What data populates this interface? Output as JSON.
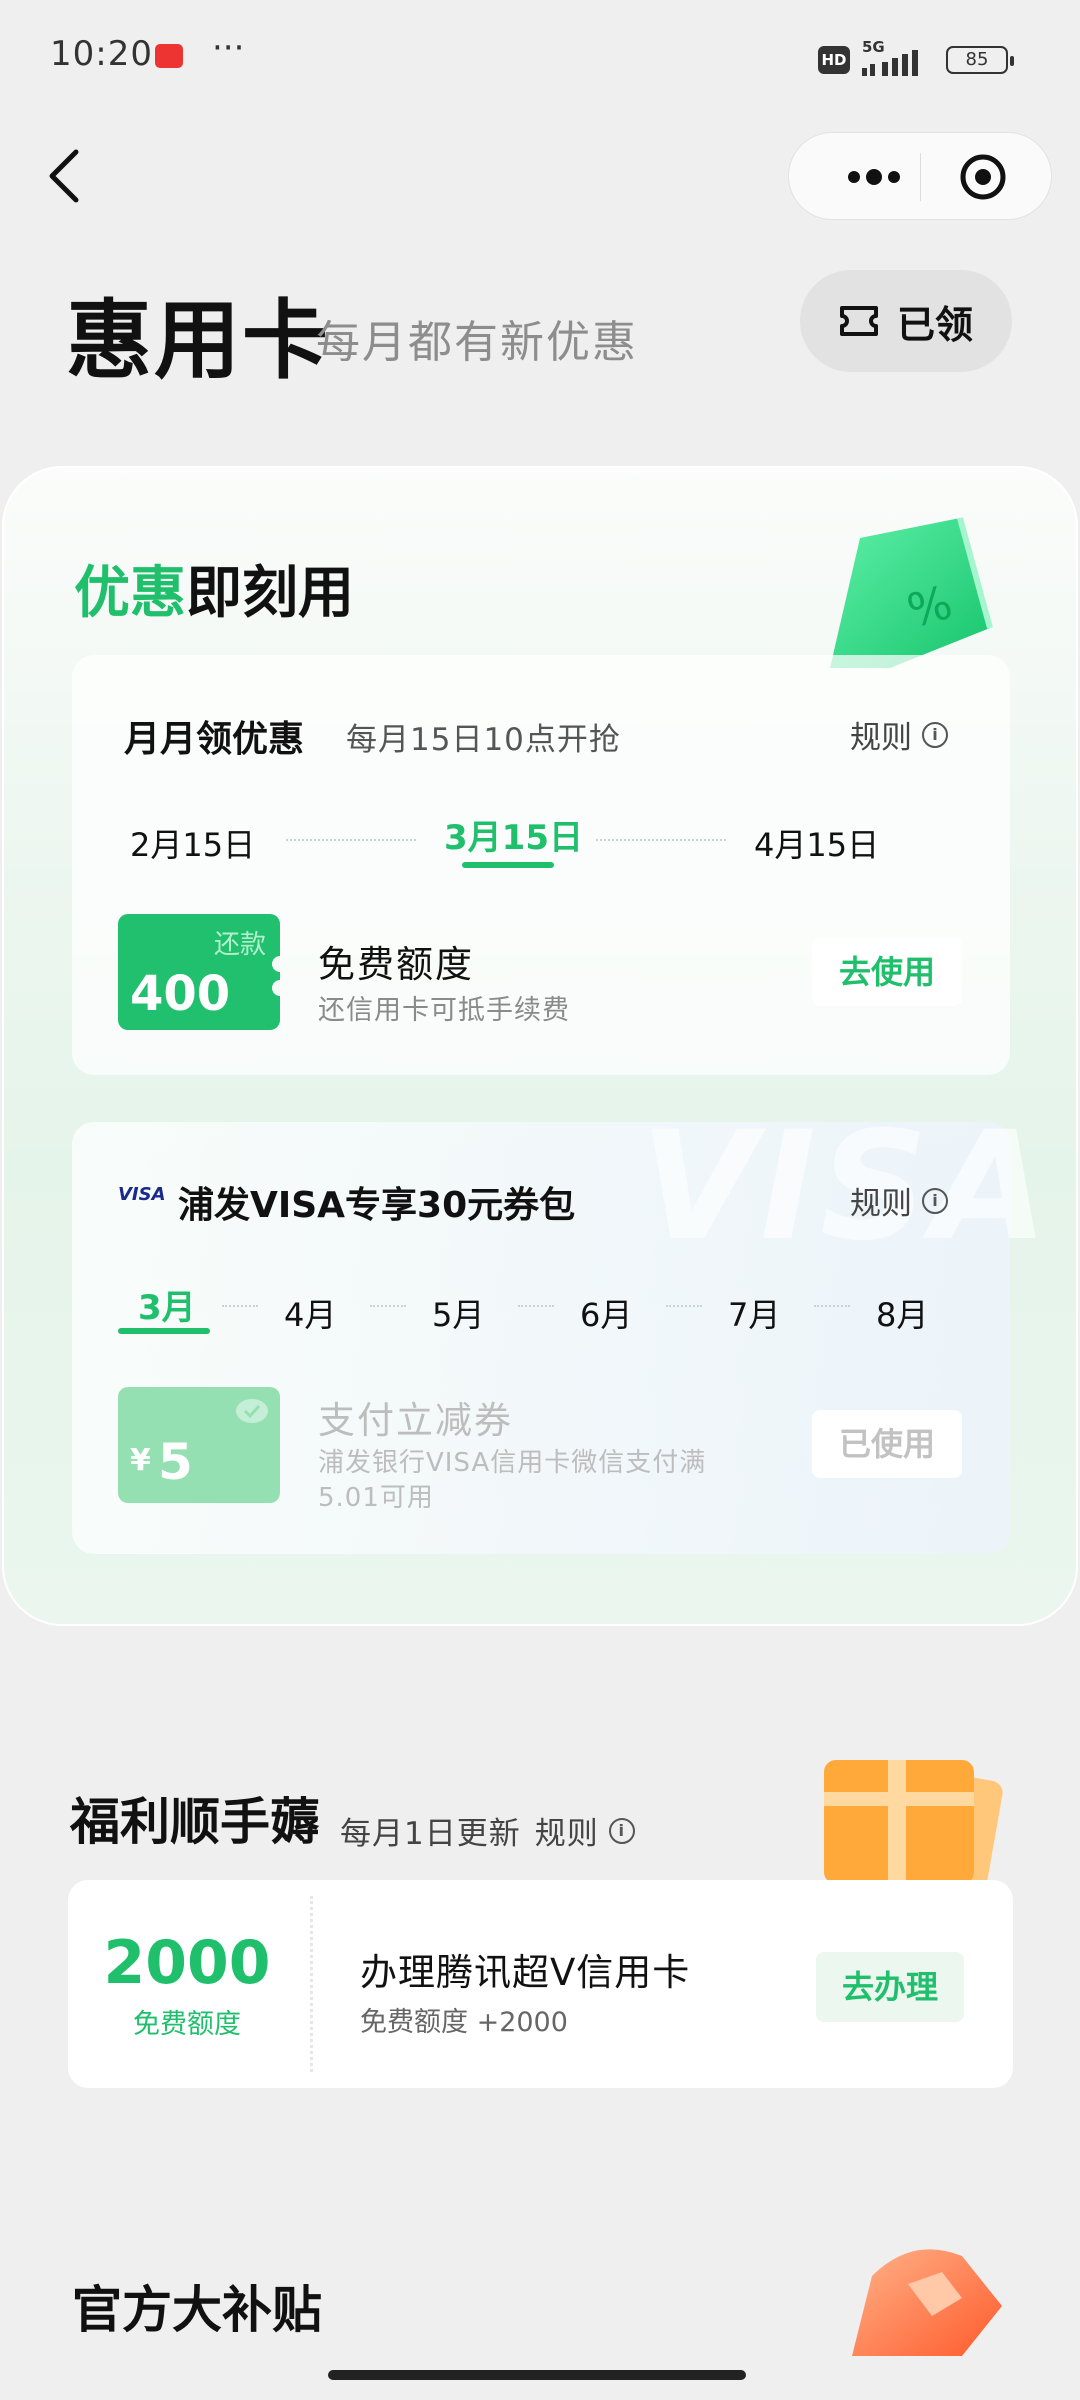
{
  "status_bar": {
    "time": "10:20",
    "more": "···",
    "hd": "HD",
    "network": "5G",
    "battery": "85"
  },
  "header": {
    "title": "惠用卡",
    "subtitle": "每月都有新优惠",
    "claimed_label": "已领"
  },
  "instant": {
    "title_green": "优惠",
    "title_black": "即刻用",
    "monthly": {
      "title": "月月领优惠",
      "subtitle": "每月15日10点开抢",
      "rule": "规则",
      "dates": [
        "2月15日",
        "3月15日",
        "4月15日"
      ],
      "active_index": 1,
      "coupon_tag": "还款",
      "coupon_amount": "400",
      "item_title": "免费额度",
      "item_desc": "还信用卡可抵手续费",
      "button": "去使用"
    },
    "visa": {
      "logo": "VISA",
      "title": "浦发VISA专享30元券包",
      "rule": "规则",
      "months": [
        "3月",
        "4月",
        "5月",
        "6月",
        "7月",
        "8月"
      ],
      "active_index": 0,
      "coupon_currency": "¥",
      "coupon_amount": "5",
      "item_title": "支付立减券",
      "item_desc_line1": "浦发银行VISA信用卡微信支付满",
      "item_desc_line2": "5.01可用",
      "button": "已使用",
      "background_text": "VISA"
    }
  },
  "welfare": {
    "title": "福利顺手薅",
    "subtitle": "每月1日更新",
    "rule": "规则",
    "amount": "2000",
    "amount_label": "免费额度",
    "item_title": "办理腾讯超V信用卡",
    "item_desc": "免费额度 +2000",
    "button": "去办理"
  },
  "official": {
    "title": "官方大补贴"
  },
  "colors": {
    "accent": "#1fbf6c",
    "background": "#efefef"
  }
}
